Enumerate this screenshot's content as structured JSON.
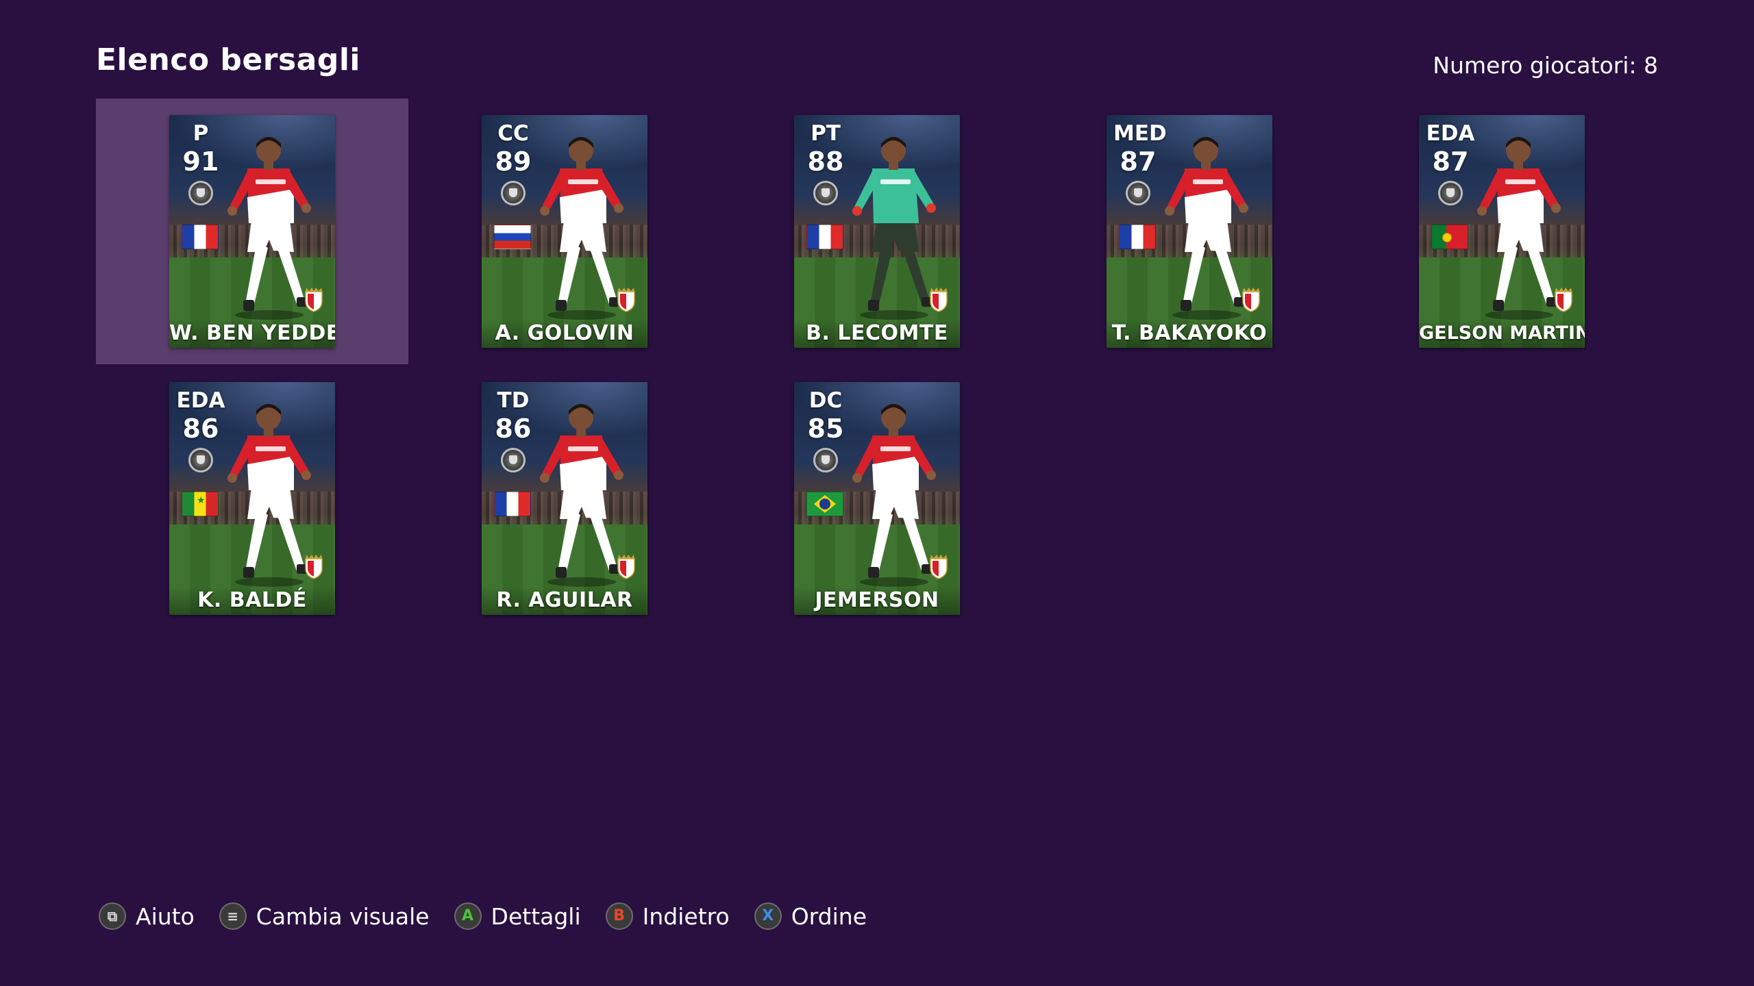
{
  "header": {
    "title": "Elenco bersagli",
    "player_count": "Numero giocatori: 8"
  },
  "cards": [
    {
      "position": "P",
      "rating": "91",
      "name": "W. BEN YEDDER",
      "flag": "france",
      "jersey": "home",
      "selected": true
    },
    {
      "position": "CC",
      "rating": "89",
      "name": "A. GOLOVIN",
      "flag": "russia",
      "jersey": "home",
      "selected": false
    },
    {
      "position": "PT",
      "rating": "88",
      "name": "B. LECOMTE",
      "flag": "france",
      "jersey": "goalkeeper",
      "selected": false
    },
    {
      "position": "MED",
      "rating": "87",
      "name": "T. BAKAYOKO",
      "flag": "france",
      "jersey": "home",
      "selected": false
    },
    {
      "position": "EDA",
      "rating": "87",
      "name": "GELSON MARTINS",
      "flag": "portugal",
      "jersey": "home",
      "selected": false
    },
    {
      "position": "EDA",
      "rating": "86",
      "name": "K. BALDÉ",
      "flag": "senegal",
      "jersey": "home",
      "selected": false
    },
    {
      "position": "TD",
      "rating": "86",
      "name": "R. AGUILAR",
      "flag": "france",
      "jersey": "home",
      "selected": false
    },
    {
      "position": "DC",
      "rating": "85",
      "name": "JEMERSON",
      "flag": "brazil",
      "jersey": "home",
      "selected": false
    }
  ],
  "footer": {
    "hints": [
      {
        "button": "view-button-icon",
        "label": "Aiuto"
      },
      {
        "button": "menu-button-icon",
        "label": "Cambia visuale"
      },
      {
        "button": "A",
        "label": "Dettagli"
      },
      {
        "button": "B",
        "label": "Indietro"
      },
      {
        "button": "X",
        "label": "Ordine"
      }
    ]
  },
  "colors": {
    "background": "#291040",
    "selection": "#5a3e6e",
    "jersey_red": "#d8202a",
    "goalkeeper_green": "#3cc09a",
    "button_a": "#4cc23a",
    "button_b": "#e8482a",
    "button_x": "#3a8ee8"
  }
}
